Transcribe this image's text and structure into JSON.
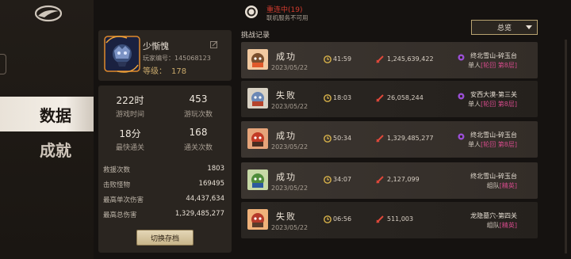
{
  "nav": {
    "items": [
      "数据",
      "成就"
    ],
    "active": "数据"
  },
  "profile": {
    "name": "少惭愧",
    "id_label": "玩家编号：",
    "id_value": "145068123",
    "level_label": "等级：",
    "level_value": "178"
  },
  "stats": {
    "grid": [
      {
        "value": "222时",
        "label": "游戏时间"
      },
      {
        "value": "453",
        "label": "游玩次数"
      },
      {
        "value": "18分",
        "label": "最快通关"
      },
      {
        "value": "168",
        "label": "通关次数"
      }
    ],
    "rows": [
      {
        "label": "救援次数",
        "value": "1803"
      },
      {
        "label": "击败怪物",
        "value": "169495"
      },
      {
        "label": "最高单次伤害",
        "value": "44,437,634"
      },
      {
        "label": "最高总伤害",
        "value": "1,329,485,277"
      }
    ],
    "switch_label": "切换存档"
  },
  "connection": {
    "status": "重连中(19)",
    "sub": "联机服务不可用"
  },
  "records_title": "挑战记录",
  "filter": {
    "selected": "总览"
  },
  "records": [
    {
      "result": "成功",
      "date": "2023/05/22",
      "time": "41:59",
      "damage": "1,245,639,422",
      "stage": "终北雪山-碎玉台",
      "team": "单人",
      "tag": "[轮回 第8层]",
      "win": true,
      "mode_color": "#9b4fd6"
    },
    {
      "result": "失败",
      "date": "2023/05/22",
      "time": "18:03",
      "damage": "26,058,244",
      "stage": "安西大漠-第三关",
      "team": "单人",
      "tag": "[轮回 第8层]",
      "win": false,
      "mode_color": "#9b4fd6"
    },
    {
      "result": "成功",
      "date": "2023/05/22",
      "time": "50:34",
      "damage": "1,329,485,277",
      "stage": "终北雪山-碎玉台",
      "team": "单人",
      "tag": "[轮回 第8层]",
      "win": true,
      "mode_color": "#9b4fd6"
    },
    {
      "result": "成功",
      "date": "2023/05/22",
      "time": "34:07",
      "damage": "2,127,099",
      "stage": "终北雪山-碎玉台",
      "team": "组队",
      "tag": "[精英]",
      "win": true,
      "mode_color": ""
    },
    {
      "result": "失败",
      "date": "2023/05/22",
      "time": "06:56",
      "damage": "511,003",
      "stage": "龙隐墓穴-第四关",
      "team": "组队",
      "tag": "[精英]",
      "win": false,
      "mode_color": ""
    }
  ],
  "colors": {
    "accent_gold": "#c9a96b",
    "fail_red": "#d23b2e",
    "tag_pink": "#d44a8a",
    "mode_purple": "#9b4fd6"
  }
}
